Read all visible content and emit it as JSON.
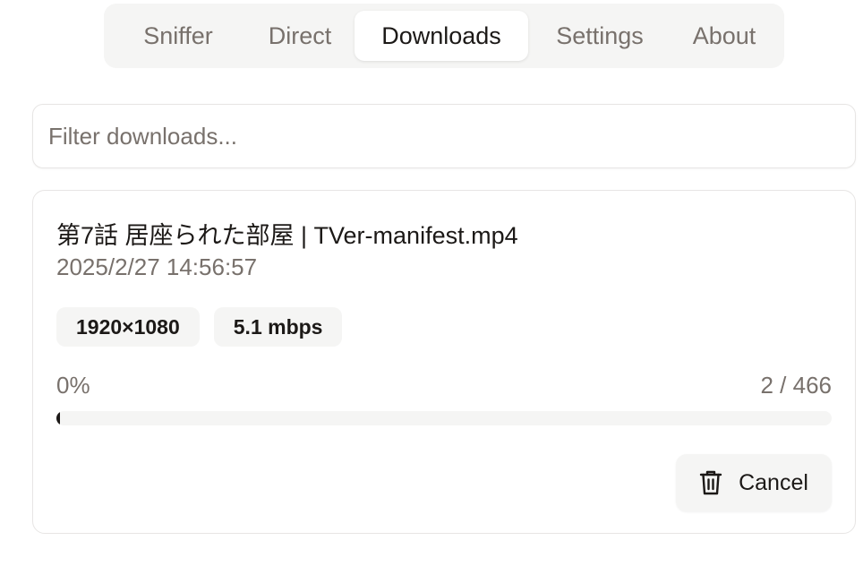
{
  "tabs": [
    {
      "label": "Sniffer",
      "active": false
    },
    {
      "label": "Direct",
      "active": false
    },
    {
      "label": "Downloads",
      "active": true
    },
    {
      "label": "Settings",
      "active": false
    },
    {
      "label": "About",
      "active": false
    }
  ],
  "filter": {
    "placeholder": "Filter downloads...",
    "value": ""
  },
  "downloads": [
    {
      "title": "第7話 居座られた部屋 | TVer-manifest.mp4",
      "timestamp": "2025/2/27 14:56:57",
      "badges": [
        "1920×1080",
        "5.1 mbps"
      ],
      "progress_text": "0%",
      "progress_fraction": 0.004,
      "segments": "2 / 466",
      "cancel_label": "Cancel",
      "cancel_icon": "trash-icon"
    }
  ],
  "colors": {
    "text": "#1c1917",
    "muted": "#78716c",
    "surface": "#f5f5f4",
    "border": "#e7e5e4",
    "progress": "#1c1917"
  }
}
